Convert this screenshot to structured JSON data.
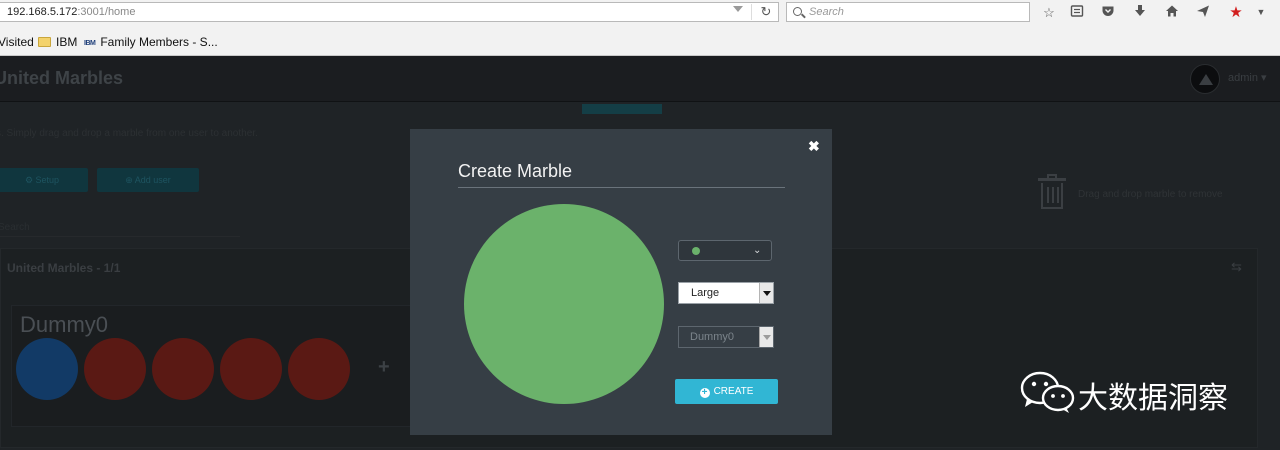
{
  "browser": {
    "url_host": "192.168.5.172",
    "url_rest": ":3001/home",
    "search_placeholder": "Search",
    "bookmarks": [
      {
        "label": "Visited"
      },
      {
        "label": "IBM"
      },
      {
        "label": "Family Members - S..."
      }
    ]
  },
  "app": {
    "title": "United Marbles",
    "user_name": "admin",
    "subtitle": "s. Simply drag and drop a marble from one user to another.",
    "buttons": {
      "setup_label": "Setup",
      "add_user_label": "Add user"
    },
    "search_label": "Search",
    "trash_text": "Drag and drop marble to remove",
    "panel_title": "United Marbles - 1/1",
    "card": {
      "name": "Dummy0",
      "marbles": [
        {
          "color": "#123a66"
        },
        {
          "color": "#5a1914"
        },
        {
          "color": "#5a1914"
        },
        {
          "color": "#5a1914"
        },
        {
          "color": "#5a1914"
        }
      ]
    }
  },
  "modal": {
    "title": "Create Marble",
    "close_icon": "close-icon",
    "color": "#6bb26b",
    "size_value": "Large",
    "owner_value": "Dummy0",
    "create_label": "CREATE"
  },
  "watermark": {
    "text": "大数据洞察"
  }
}
